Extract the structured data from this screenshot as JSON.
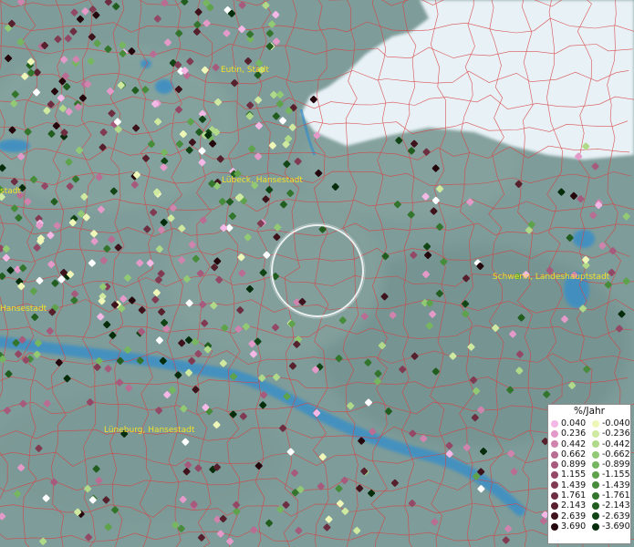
{
  "map": {
    "cities": [
      {
        "name": "Eutin, Stadt",
        "lon": 245,
        "lat": 79
      },
      {
        "name": "Lübeck, Hansestadt",
        "lon": 246,
        "lat": 200
      },
      {
        "name": "Schwerin, Landeshauptstadt",
        "lon": 542,
        "lat": 305
      },
      {
        "name": "Hansestadt",
        "lon": 0,
        "lat": 340
      },
      {
        "name": "stadt",
        "lon": 0,
        "lat": 211
      },
      {
        "name": "Lüneburg, Hansestadt",
        "lon": 117,
        "lat": 473
      }
    ]
  },
  "legend": {
    "title": "%/Jahr",
    "positive": [
      {
        "label": "0.040",
        "color": "#f4b8e6"
      },
      {
        "label": "0.236",
        "color": "#e39ac8"
      },
      {
        "label": "0.442",
        "color": "#cf84ae"
      },
      {
        "label": "0.662",
        "color": "#b96d93"
      },
      {
        "label": "0.899",
        "color": "#a65a7c"
      },
      {
        "label": "1.155",
        "color": "#934966"
      },
      {
        "label": "1.439",
        "color": "#803b52"
      },
      {
        "label": "1.761",
        "color": "#6c2e40"
      },
      {
        "label": "2.143",
        "color": "#56202d"
      },
      {
        "label": "2.639",
        "color": "#3e131c"
      },
      {
        "label": "3.690",
        "color": "#24070c"
      }
    ],
    "negative": [
      {
        "label": "-0.040",
        "color": "#eef7b8"
      },
      {
        "label": "-0.236",
        "color": "#cfeaa0"
      },
      {
        "label": "-0.442",
        "color": "#b0da8a"
      },
      {
        "label": "-0.662",
        "color": "#92c974"
      },
      {
        "label": "-0.899",
        "color": "#77b660"
      },
      {
        "label": "-1.155",
        "color": "#5ea24c"
      },
      {
        "label": "-1.439",
        "color": "#478c3b"
      },
      {
        "label": "-1.761",
        "color": "#33752c"
      },
      {
        "label": "-2.143",
        "color": "#215d1f"
      },
      {
        "label": "-2.639",
        "color": "#124515"
      },
      {
        "label": "-3.690",
        "color": "#062d0b"
      }
    ]
  }
}
